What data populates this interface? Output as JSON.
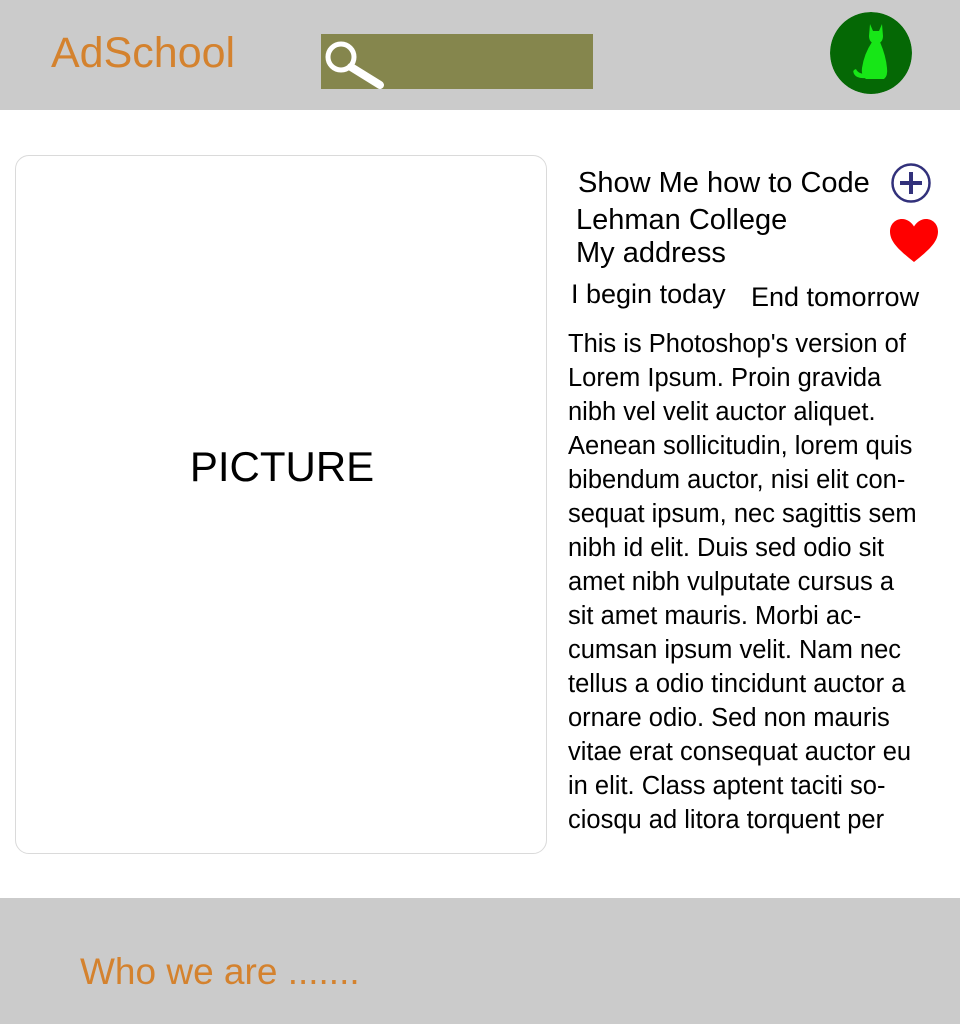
{
  "colors": {
    "brand_orange": "#d4822e",
    "header_bg": "#cbcbcb",
    "search_bg": "#85864d",
    "avatar_bg": "#056805",
    "avatar_cat": "#17e617",
    "add_icon": "#32317b",
    "heart": "#ff0000"
  },
  "header": {
    "logo": "AdSchool",
    "search": {
      "value": "",
      "icon": "search-icon"
    },
    "avatar": {
      "icon": "cat-icon"
    }
  },
  "main": {
    "picture": {
      "label": "PICTURE"
    },
    "course": {
      "title": "Show Me how to Code",
      "college": "Lehman College",
      "address": "My address",
      "start": "I begin today",
      "end": "End tomorrow",
      "add_icon": "plus-circle-icon",
      "favorite_icon": "heart-icon",
      "description": "This is Photoshop's version  of\nLorem Ipsum. Proin gravida\nnibh vel velit auctor aliquet.\nAenean sollicitudin, lorem quis\nbibendum auctor, nisi elit con-\nsequat ipsum, nec sagittis sem\nnibh id elit. Duis sed odio sit\namet nibh vulputate cursus a\nsit amet mauris. Morbi ac-\ncumsan ipsum velit. Nam nec\ntellus a odio tincidunt auctor a\nornare odio. Sed non  mauris\nvitae erat consequat auctor eu\nin elit. Class aptent taciti so-\nciosqu ad litora torquent per"
    }
  },
  "footer": {
    "link": "Who we are ......."
  }
}
